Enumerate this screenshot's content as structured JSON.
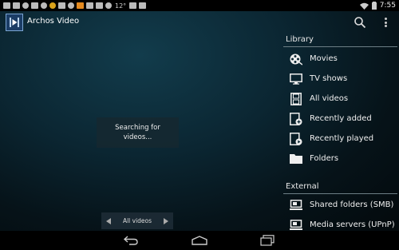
{
  "status_bar": {
    "temperature": "12°",
    "time": "7:55",
    "left_icons": [
      "notification-icon",
      "sd-card-icon",
      "cloud-icon",
      "mail-icon",
      "chat-icon",
      "gold-icon",
      "mail-icon",
      "bug-icon",
      "lock-icon",
      "mail-icon",
      "image-icon",
      "temperature-icon",
      "checkbox-icon",
      "checkbox-icon"
    ],
    "right_icons": [
      "wifi-icon",
      "battery-icon"
    ]
  },
  "action_bar": {
    "title": "Archos Video",
    "icons": [
      "app-logo-icon",
      "search-icon",
      "overflow-menu-icon"
    ]
  },
  "main": {
    "searching_text": "Searching for\nvideos..."
  },
  "pager": {
    "label": "All videos"
  },
  "drawer": {
    "library_header": "Library",
    "library_items": [
      {
        "label": "Movies",
        "icon": "film-reel-icon"
      },
      {
        "label": "TV shows",
        "icon": "tv-icon"
      },
      {
        "label": "All videos",
        "icon": "film-strip-icon"
      },
      {
        "label": "Recently added",
        "icon": "film-add-icon"
      },
      {
        "label": "Recently played",
        "icon": "film-play-icon"
      },
      {
        "label": "Folders",
        "icon": "folder-icon"
      }
    ],
    "external_header": "External",
    "external_items": [
      {
        "label": "Shared folders (SMB)",
        "icon": "network-share-icon"
      },
      {
        "label": "Media servers (UPnP)",
        "icon": "media-server-icon"
      }
    ]
  },
  "nav_bar": {
    "buttons": [
      "back-icon",
      "home-icon",
      "recents-icon"
    ]
  },
  "colors": {
    "background_center": "#123c4c",
    "background_edge": "#03090c",
    "divider": "#6c7e85",
    "text": "#ffffff"
  }
}
